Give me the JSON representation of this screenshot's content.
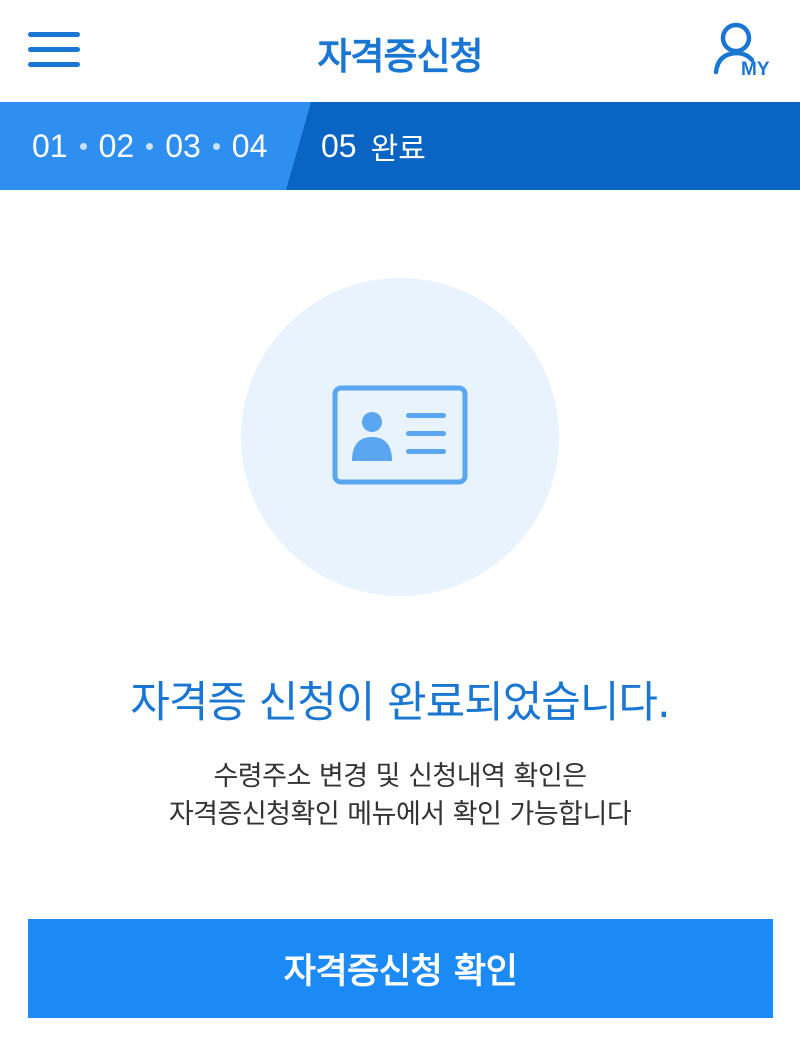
{
  "header": {
    "title": "자격증신청",
    "menu_icon": "hamburger-menu-icon",
    "my_icon": "user-icon",
    "my_label": "MY"
  },
  "steps": {
    "done": [
      "01",
      "02",
      "03",
      "04"
    ],
    "current_number": "05",
    "current_label": "완료"
  },
  "illustration": {
    "icon": "id-card-icon"
  },
  "message": {
    "title": "자격증 신청이 완료되었습니다.",
    "line1": "수령주소 변경 및 신청내역 확인은",
    "line2": "자격증신청확인 메뉴에서 확인 가능합니다"
  },
  "button": {
    "label": "자격증신청 확인"
  },
  "colors": {
    "accent": "#1976d2",
    "step_done_bg": "#2f8ff0",
    "step_current_bg": "#0a64c4",
    "illustration_bg": "#e9f3fd",
    "icon_stroke": "#5aa6f0",
    "button_bg": "#1c8af5"
  }
}
